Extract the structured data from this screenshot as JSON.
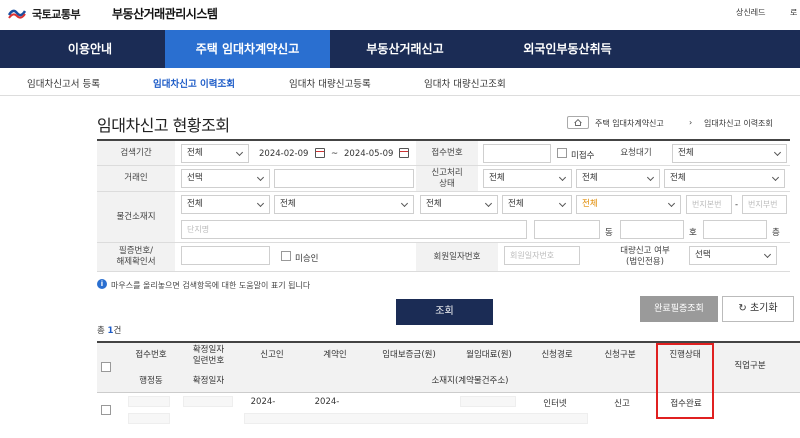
{
  "header": {
    "ministry": "국토교통부",
    "system_name": "부동산거래관리시스템",
    "user_link": "상신레드",
    "user_link2": "로"
  },
  "gnb": [
    {
      "label": "이용안내"
    },
    {
      "label": "주택 임대차계약신고",
      "active": true
    },
    {
      "label": "부동산거래신고"
    },
    {
      "label": "외국인부동산취득"
    }
  ],
  "lnb": [
    {
      "label": "임대차신고서 등록"
    },
    {
      "label": "임대차신고 이력조회",
      "active": true
    },
    {
      "label": "임대차 대량신고등록"
    },
    {
      "label": "임대차 대량신고조회"
    }
  ],
  "page": {
    "title": "임대차신고 현황조회",
    "breadcrumb_1": "주택 임대차계약신고",
    "breadcrumb_2": "임대차신고 이력조회"
  },
  "search": {
    "period_label": "검색기간",
    "period_select": "전체",
    "date_from": "2024-02-09",
    "date_sep": "~",
    "date_to": "2024-05-09",
    "receipt_no_label": "접수번호",
    "unreceived_label": "미접수",
    "request_label": "요청대기",
    "request_select": "전체",
    "party_label": "거래인",
    "party_select": "선택",
    "status_label": "신고처리\n상태",
    "status_select_1": "전체",
    "status_select_2": "전체",
    "status_select_3": "전체",
    "location_label": "물건소재지",
    "loc_1": "전체",
    "loc_2": "전체",
    "loc_3": "전체",
    "loc_4": "전체",
    "loc_5": "전체",
    "main_no_placeholder": "번지본번",
    "sub_no_placeholder": "번지부번",
    "hyphen": "-",
    "complex_placeholder": "단지명",
    "dong_label": "동",
    "ho_label": "호",
    "floor_label": "층",
    "cert_label": "필증번호/\n해제확인서",
    "unapproved_label": "미승인",
    "member_label": "회원일자번호",
    "member_placeholder": "회원일자번호",
    "bulk_label": "대량신고 여부\n(법인전용)",
    "bulk_select": "선택"
  },
  "info_text": "마우스를 올리놓으면 검색항목에 대한 도움말이 표기 됩니다",
  "buttons": {
    "search": "조회",
    "cert_lookup": "완료필증조회",
    "reset": "초기화"
  },
  "total": {
    "prefix": "총 ",
    "count": "1",
    "suffix": "건"
  },
  "table": {
    "headers": {
      "receipt_no": "접수번호",
      "contract_date": "확정일자\n일련번호",
      "reporter": "신고인",
      "contractor": "계약인",
      "deposit": "임대보증금(원)",
      "monthly_rent": "월임대료(원)",
      "report_path": "신청경로",
      "report_type": "신청구분",
      "progress": "진행상태",
      "work_type": "직업구분",
      "admin_dong": "행정동",
      "fixed_date": "확정일자",
      "address": "소재지(계약물건주소)"
    },
    "rows": [
      {
        "reporter_date": "2024-",
        "contractor_date": "2024-",
        "report_path": "인터넷",
        "report_type": "신고",
        "progress": "접수완료"
      }
    ]
  }
}
